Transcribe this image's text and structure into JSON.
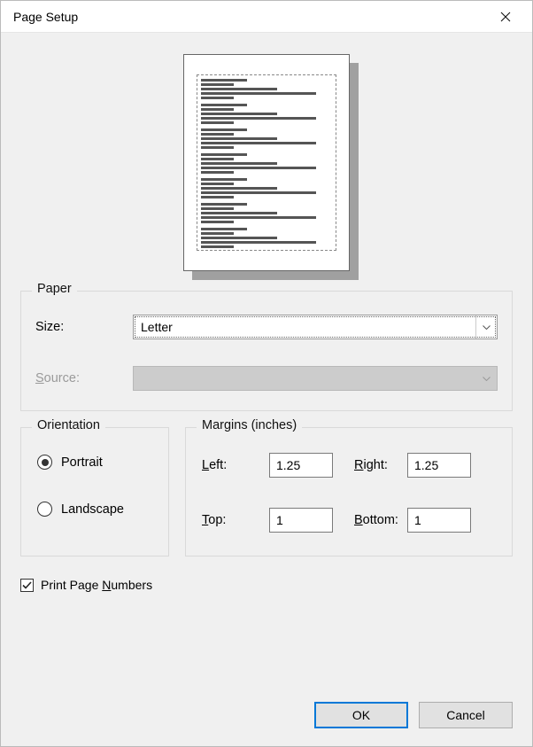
{
  "title": "Page Setup",
  "paper": {
    "legend": "Paper",
    "size_label": "Size:",
    "size_value": "Letter",
    "source_label_pre": "S",
    "source_label_post": "ource:",
    "source_value": ""
  },
  "orientation": {
    "legend": "Orientation",
    "portrait_label": "Portrait",
    "landscape_label": "Landscape",
    "selected": "portrait"
  },
  "margins": {
    "legend": "Margins (inches)",
    "left_label_pre": "L",
    "left_label_post": "eft:",
    "right_label_pre": "R",
    "right_label_post": "ight:",
    "top_label_pre": "T",
    "top_label_post": "op:",
    "bottom_label_pre": "B",
    "bottom_label_post": "ottom:",
    "left": "1.25",
    "right": "1.25",
    "top": "1",
    "bottom": "1"
  },
  "print_page_numbers": {
    "label_pre": "Print Page ",
    "label_ul": "N",
    "label_post": "umbers",
    "checked": true
  },
  "buttons": {
    "ok": "OK",
    "cancel": "Cancel"
  }
}
